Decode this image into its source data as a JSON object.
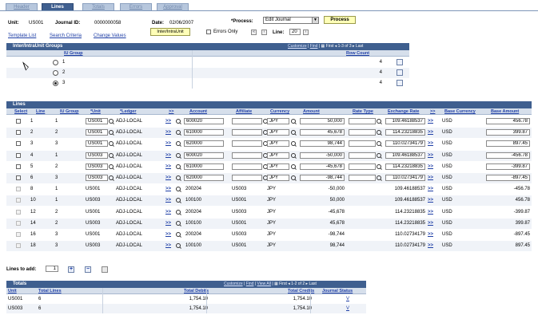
{
  "tabs": [
    {
      "label": "Header",
      "active": false
    },
    {
      "label": "Lines",
      "active": true
    },
    {
      "label": "Totals",
      "active": false
    },
    {
      "label": "Errors",
      "active": false
    },
    {
      "label": "Approval",
      "active": false
    }
  ],
  "header": {
    "unit_label": "Unit:",
    "unit_value": "US001",
    "journal_id_label": "Journal ID:",
    "journal_id_value": "0000000058",
    "date_label": "Date:",
    "date_value": "02/06/2007",
    "process_label": "*Process:",
    "process_value": "Edit Journal",
    "process_button": "Process",
    "template_link": "Template List",
    "search_link": "Search Criteria",
    "change_link": "Change Values",
    "interintra_button": "Inter/IntraUnit",
    "errors_only_label": "Errors Only",
    "line_label": "Line:",
    "line_value": "20"
  },
  "iu_groups": {
    "title": "Inter/IntraUnit Groups",
    "nav_customize": "Customize",
    "nav_find": "Find",
    "nav_first": "First",
    "nav_range": "1-3 of 3",
    "nav_last": "Last",
    "col_group": "IU Group",
    "col_rowcount": "Row Count",
    "rows": [
      {
        "group": "1",
        "count": "4",
        "selected": false
      },
      {
        "group": "2",
        "count": "4",
        "selected": false
      },
      {
        "group": "3",
        "count": "4",
        "selected": true
      }
    ]
  },
  "lines": {
    "title": "Lines",
    "columns": [
      "Select",
      "Line",
      "IU Group",
      "*Unit",
      "*Ledger",
      ">>",
      "Account",
      "Affiliate",
      "Currency",
      "Amount",
      "Rate Type",
      "Exchange Rate",
      ">>",
      "Base Currency",
      "Base Amount"
    ],
    "arrow_label": ">>",
    "rows": [
      {
        "line": "1",
        "group": "1",
        "unit": "US001",
        "ledger": "ADJ-LOCAL",
        "account": "600020",
        "affiliate": "",
        "currency": "JPY",
        "amount": "50,000",
        "rate": "109.46188537",
        "base_currency": "USD",
        "base_amount": "456.78",
        "editable": true
      },
      {
        "line": "2",
        "group": "2",
        "unit": "US001",
        "ledger": "ADJ-LOCAL",
        "account": "610000",
        "affiliate": "",
        "currency": "JPY",
        "amount": "45,678",
        "rate": "114.23218835",
        "base_currency": "USD",
        "base_amount": "399.87",
        "editable": true
      },
      {
        "line": "3",
        "group": "3",
        "unit": "US001",
        "ledger": "ADJ-LOCAL",
        "account": "620000",
        "affiliate": "",
        "currency": "JPY",
        "amount": "98,744",
        "rate": "110.02734179",
        "base_currency": "USD",
        "base_amount": "897.45",
        "editable": true
      },
      {
        "line": "4",
        "group": "1",
        "unit": "US003",
        "ledger": "ADJ-LOCAL",
        "account": "600020",
        "affiliate": "",
        "currency": "JPY",
        "amount": "-50,000",
        "rate": "109.46188537",
        "base_currency": "USD",
        "base_amount": "-456.78",
        "editable": true
      },
      {
        "line": "5",
        "group": "2",
        "unit": "US003",
        "ledger": "ADJ-LOCAL",
        "account": "610000",
        "affiliate": "",
        "currency": "JPY",
        "amount": "-45,678",
        "rate": "114.23218835",
        "base_currency": "USD",
        "base_amount": "-399.87",
        "editable": true
      },
      {
        "line": "6",
        "group": "3",
        "unit": "US003",
        "ledger": "ADJ-LOCAL",
        "account": "620000",
        "affiliate": "",
        "currency": "JPY",
        "amount": "-98,744",
        "rate": "110.02734179",
        "base_currency": "USD",
        "base_amount": "-897.45",
        "editable": true
      },
      {
        "line": "8",
        "group": "1",
        "unit": "US001",
        "ledger": "ADJ-LOCAL",
        "account": "200204",
        "affiliate": "US003",
        "currency": "JPY",
        "amount": "-50,000",
        "rate": "109.46188537",
        "base_currency": "USD",
        "base_amount": "-456.78",
        "editable": false
      },
      {
        "line": "10",
        "group": "1",
        "unit": "US003",
        "ledger": "ADJ-LOCAL",
        "account": "100100",
        "affiliate": "US001",
        "currency": "JPY",
        "amount": "50,000",
        "rate": "109.46188537",
        "base_currency": "USD",
        "base_amount": "456.78",
        "editable": false
      },
      {
        "line": "12",
        "group": "2",
        "unit": "US001",
        "ledger": "ADJ-LOCAL",
        "account": "200204",
        "affiliate": "US003",
        "currency": "JPY",
        "amount": "-45,678",
        "rate": "114.23218835",
        "base_currency": "USD",
        "base_amount": "-399.87",
        "editable": false
      },
      {
        "line": "14",
        "group": "2",
        "unit": "US003",
        "ledger": "ADJ-LOCAL",
        "account": "100100",
        "affiliate": "US001",
        "currency": "JPY",
        "amount": "45,678",
        "rate": "114.23218835",
        "base_currency": "USD",
        "base_amount": "399.87",
        "editable": false
      },
      {
        "line": "16",
        "group": "3",
        "unit": "US001",
        "ledger": "ADJ-LOCAL",
        "account": "200204",
        "affiliate": "US003",
        "currency": "JPY",
        "amount": "-98,744",
        "rate": "110.02734179",
        "base_currency": "USD",
        "base_amount": "-897.45",
        "editable": false
      },
      {
        "line": "18",
        "group": "3",
        "unit": "US003",
        "ledger": "ADJ-LOCAL",
        "account": "100100",
        "affiliate": "US001",
        "currency": "JPY",
        "amount": "98,744",
        "rate": "110.02734179",
        "base_currency": "USD",
        "base_amount": "897.45",
        "editable": false
      }
    ]
  },
  "lines_to_add": {
    "label": "Lines to add:",
    "value": "1"
  },
  "totals": {
    "title": "Totals",
    "nav_customize": "Customize",
    "nav_find": "Find",
    "nav_viewall": "View All",
    "nav_first": "First",
    "nav_range": "1-2 of 2",
    "nav_last": "Last",
    "columns": [
      "Unit",
      "Total Lines",
      "Total Debits",
      "Total Credits",
      "Journal Status"
    ],
    "rows": [
      {
        "unit": "US001",
        "lines": "6",
        "debits": "1,754.10",
        "credits": "1,754.10",
        "status": "V"
      },
      {
        "unit": "US003",
        "lines": "6",
        "debits": "1,754.10",
        "credits": "1,754.10",
        "status": "V"
      }
    ]
  }
}
